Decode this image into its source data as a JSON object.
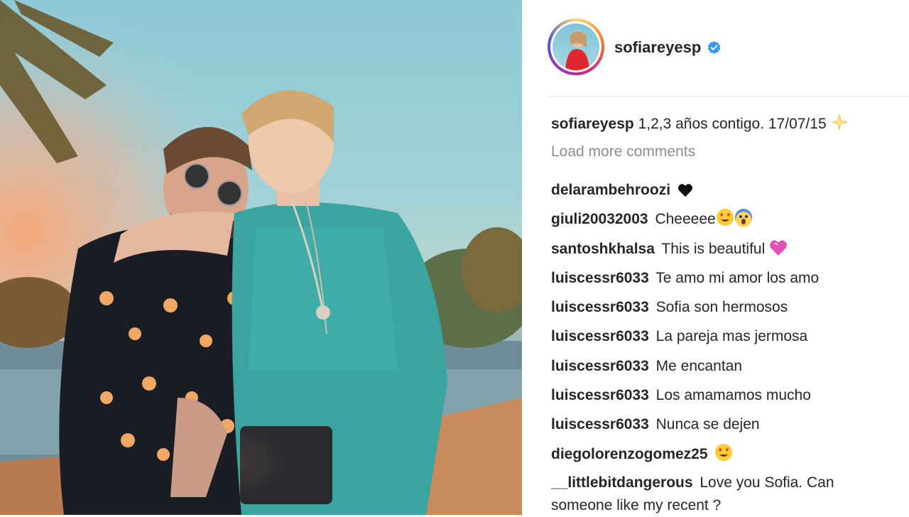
{
  "post": {
    "username": "sofiareyesp",
    "caption_text": "1,2,3 años contigo. 17/07/15",
    "load_more_label": "Load more comments"
  },
  "icons": {
    "verified": "verified-badge-icon",
    "caption_emoji": "sparkle-star-icon"
  },
  "colors": {
    "verified_blue": "#3897f0",
    "muted_text": "#8e8e8e",
    "text": "#262626"
  },
  "comments": [
    {
      "user": "delarambehroozi",
      "text": "",
      "emoji": "black-heart-icon"
    },
    {
      "user": "giuli20032003",
      "text": "Cheeeee",
      "emoji": "heart-eyes-and-scream-icons"
    },
    {
      "user": "santoshkhalsa",
      "text": "This is beautiful",
      "emoji": "pink-heart-icon"
    },
    {
      "user": "luiscessr6033",
      "text": "Te amo mi amor los amo"
    },
    {
      "user": "luiscessr6033",
      "text": "Sofia son hermosos"
    },
    {
      "user": "luiscessr6033",
      "text": "La pareja mas jermosa"
    },
    {
      "user": "luiscessr6033",
      "text": "Me encantan"
    },
    {
      "user": "luiscessr6033",
      "text": "Los amamamos mucho"
    },
    {
      "user": "luiscessr6033",
      "text": "Nunca se dejen"
    },
    {
      "user": "diegolorenzogomez25",
      "text": "",
      "emoji": "heart-eyes-icon"
    },
    {
      "user": "__littlebitdangerous",
      "text": "Love you Sofia. Can someone like my recent ?"
    }
  ]
}
